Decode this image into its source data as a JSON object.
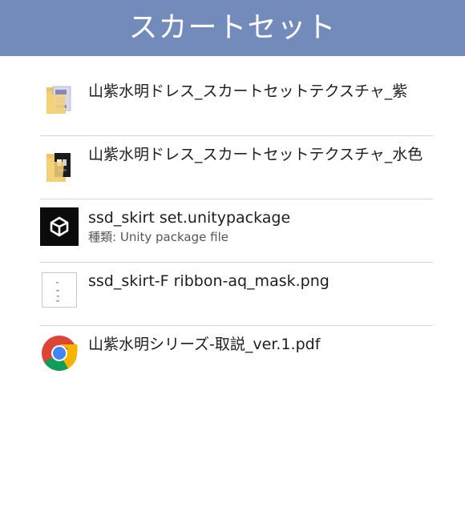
{
  "header": {
    "title": "スカートセット",
    "background": "#728bba"
  },
  "files": [
    {
      "name": "山紫水明ドレス_スカートセットテクスチャ_紫",
      "icon": "folder-icon"
    },
    {
      "name": "山紫水明ドレス_スカートセットテクスチャ_水色",
      "icon": "folder-icon"
    },
    {
      "name": "ssd_skirt set.unitypackage",
      "type_label": "種類:",
      "type_value": "Unity package file",
      "icon": "unity-icon"
    },
    {
      "name": "ssd_skirt-F ribbon-aq_mask.png",
      "icon": "image-thumbnail-icon"
    },
    {
      "name": "山紫水明シリーズ-取説_ver.1.pdf",
      "icon": "chrome-icon"
    }
  ]
}
